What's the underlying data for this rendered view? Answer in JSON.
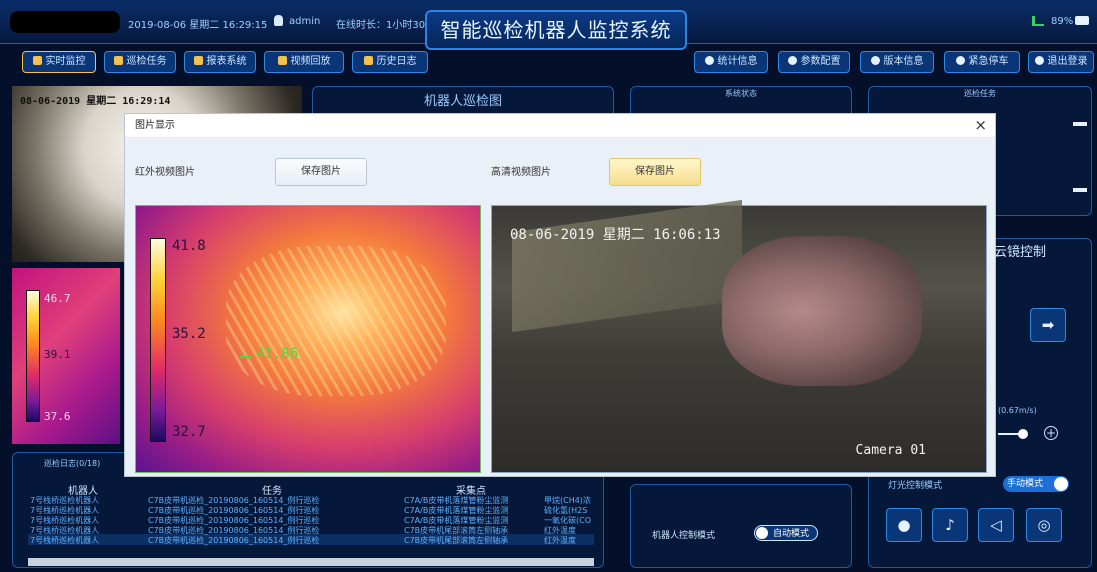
{
  "topbar": {
    "datetime": "2019-08-06 星期二 16:29:15",
    "user": "admin",
    "online": "在线时长：1小时30分",
    "title": "智能巡检机器人监控系统",
    "battery": "89%"
  },
  "nav_left": [
    {
      "label": "实时监控"
    },
    {
      "label": "巡检任务"
    },
    {
      "label": "报表系统"
    },
    {
      "label": "视频回放"
    },
    {
      "label": "历史日志"
    }
  ],
  "nav_right": [
    {
      "label": "统计信息"
    },
    {
      "label": "参数配置"
    },
    {
      "label": "版本信息"
    },
    {
      "label": "紧急停车"
    },
    {
      "label": "退出登录"
    }
  ],
  "camera_small": {
    "timestamp": "08-06-2019 星期二 16:29:14"
  },
  "ir_small": {
    "ticks": [
      "46.7",
      "39.1",
      "37.6"
    ]
  },
  "panels": {
    "map_title": "机器人巡检图",
    "status_title": "系统状态",
    "task_title": "巡检任务",
    "ptz_title": "云镜控制",
    "speed": "(0.67m/s)",
    "light_mode_label": "灯光控制模式",
    "light_mode_value": "手动模式",
    "robot_mode_label": "机器人控制模式",
    "robot_mode_value": "自动模式"
  },
  "log": {
    "tab": "巡检日志(0/18)",
    "headers": [
      "机器人",
      "任务",
      "采集点"
    ],
    "rows": [
      {
        "robot": "7号栈桥巡检机器人",
        "task": "C7B皮带机巡检_20190806_160514_例行巡检",
        "point": "C7A/B皮带机落煤管粉尘监测",
        "extra": "甲烷(CH4)浓"
      },
      {
        "robot": "7号栈桥巡检机器人",
        "task": "C7B皮带机巡检_20190806_160514_例行巡检",
        "point": "C7A/B皮带机落煤管粉尘监测",
        "extra": "硫化氢(H2S"
      },
      {
        "robot": "7号栈桥巡检机器人",
        "task": "C7B皮带机巡检_20190806_160514_例行巡检",
        "point": "C7A/B皮带机落煤管粉尘监测",
        "extra": "一氧化碳(CO"
      },
      {
        "robot": "7号栈桥巡检机器人",
        "task": "C7B皮带机巡检_20190806_160514_例行巡检",
        "point": "C7B皮带机尾部滚筒左侧轴承",
        "extra": "红外温度"
      },
      {
        "robot": "7号栈桥巡检机器人",
        "task": "C7B皮带机巡检_20190806_160514_例行巡检",
        "point": "C7B皮带机尾部滚筒左侧轴承",
        "extra": "红外温度"
      }
    ]
  },
  "dialog": {
    "title": "图片显示",
    "close": "×",
    "ir_label": "红外视频图片",
    "hd_label": "高清视频图片",
    "save_label": "保存图片",
    "ir_ticks": [
      "41.8",
      "35.2",
      "32.7"
    ],
    "ir_spot": "41.86",
    "hd_timestamp": "08-06-2019 星期二 16:06:13",
    "hd_camera": "Camera 01"
  }
}
